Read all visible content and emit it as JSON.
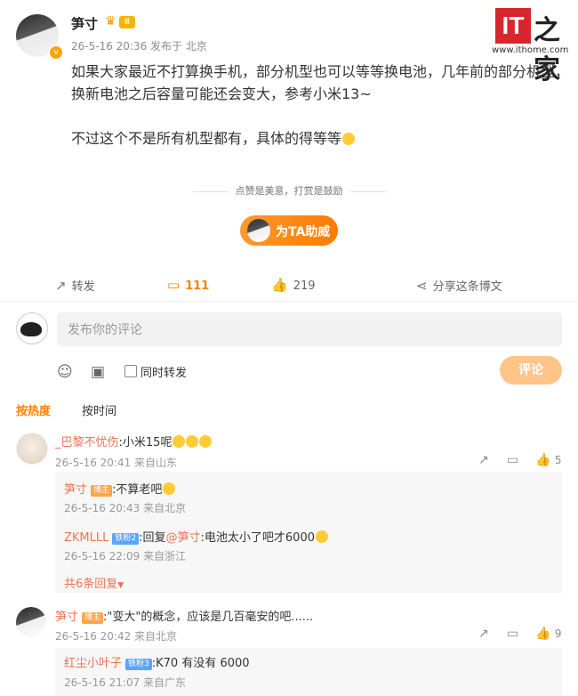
{
  "post": {
    "author": "笋寸",
    "level_badge": "Ⅲ",
    "meta": "26-5-16 20:36  发布于 北京",
    "paragraphs": [
      "如果大家最近不打算换手机，部分机型也可以等等换电池，几年前的部分机型，换新电池之后容量可能还会变大，参考小米13~",
      "不过这个不是所有机型都有，具体的得等等"
    ],
    "reward_hint": "点赞是美意，打赏是鼓励",
    "boost_label": "为TA助威"
  },
  "watermark": {
    "it": "IT",
    "zh": "之家",
    "url": "www.ithome.com"
  },
  "actions": {
    "repost_label": "转发",
    "comments_count": "111",
    "likes_count": "219",
    "share_label": "分享这条博文"
  },
  "comment_box": {
    "placeholder": "发布你的评论",
    "sync_repost_label": "同时转发",
    "submit_label": "评论"
  },
  "sort": {
    "hot": "按热度",
    "time": "按时间"
  },
  "comments": [
    {
      "user": "_巴黎不忧伤",
      "text": ":小米15呢",
      "time": "26-5-16 20:41 来自山东",
      "likes": "5",
      "replies": [
        {
          "user": "笋寸",
          "tag": "博主",
          "text": ":不算老吧",
          "time": "26-5-16 20:43 来自北京"
        },
        {
          "user": "ZKMLLL",
          "tag": "铁粉2",
          "prefix": ":回复",
          "mention": "@笋寸",
          "text": ":电池太小了吧才6000",
          "time": "26-5-16 22:09 来自浙江"
        }
      ],
      "more_replies": "共6条回复"
    },
    {
      "user": "笋寸",
      "tag": "博主",
      "text": ":\"变大\"的概念，应该是几百毫安的吧......",
      "time": "26-5-16 20:42 来自北京",
      "likes": "9",
      "replies": [
        {
          "user": "红尘小叶子",
          "tag": "铁粉3",
          "text": ":K70 有没有 6000",
          "time": "26-5-16 21:07 来自广东"
        }
      ]
    }
  ],
  "colors": {
    "accent": "#ff8200",
    "username": "#eb7350",
    "watermark_red": "#d8262c"
  },
  "icons": [
    "repost-icon",
    "comment-icon",
    "like-icon",
    "share-icon",
    "emoji-icon",
    "image-icon",
    "reply-icon",
    "chevron-down-icon"
  ]
}
